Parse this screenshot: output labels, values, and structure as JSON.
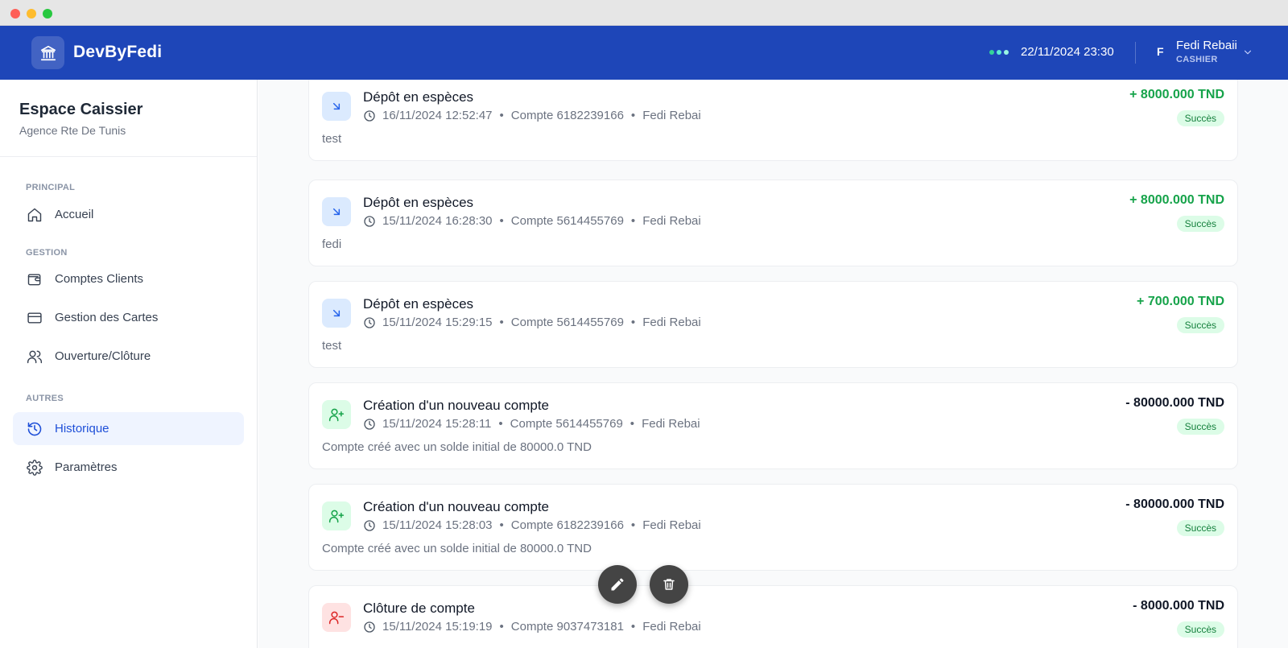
{
  "brand": {
    "name": "DevByFedi",
    "icon": "bank-icon"
  },
  "header": {
    "datetime": "22/11/2024 23:30",
    "status_colors": [
      "#34d399",
      "#5eead4",
      "#99f6e4"
    ],
    "user": {
      "initial": "F",
      "name": "Fedi Rebaii",
      "role": "CASHIER"
    }
  },
  "sidebar": {
    "title": "Espace Caissier",
    "subtitle": "Agence Rte De Tunis",
    "sections": {
      "principal": "PRINCIPAL",
      "gestion": "GESTION",
      "autres": "AUTRES"
    },
    "items": [
      {
        "label": "Accueil",
        "icon": "home-icon"
      },
      {
        "label": "Comptes Clients",
        "icon": "wallet-icon"
      },
      {
        "label": "Gestion des Cartes",
        "icon": "credit-card-icon"
      },
      {
        "label": "Ouverture/Clôture",
        "icon": "users-icon"
      },
      {
        "label": "Historique",
        "icon": "history-icon",
        "active": true
      },
      {
        "label": "Paramètres",
        "icon": "settings-icon"
      }
    ]
  },
  "transactions": [
    {
      "title": "Dépôt en espèces",
      "date": "16/11/2024 12:52:47",
      "account": "Compte 6182239166",
      "user": "Fedi Rebai",
      "desc": "test",
      "amount": "+ 8000.000 TND",
      "status": "Succès",
      "type": "deposit"
    },
    {
      "title": "Dépôt en espèces",
      "date": "15/11/2024 16:28:30",
      "account": "Compte 5614455769",
      "user": "Fedi Rebai",
      "desc": "fedi",
      "amount": "+ 8000.000 TND",
      "status": "Succès",
      "type": "deposit"
    },
    {
      "title": "Dépôt en espèces",
      "date": "15/11/2024 15:29:15",
      "account": "Compte 5614455769",
      "user": "Fedi Rebai",
      "desc": "test",
      "amount": "+ 700.000 TND",
      "status": "Succès",
      "type": "deposit"
    },
    {
      "title": "Création d'un nouveau compte",
      "date": "15/11/2024 15:28:11",
      "account": "Compte 5614455769",
      "user": "Fedi Rebai",
      "desc": "Compte créé avec un solde initial de 80000.0 TND",
      "amount": "- 80000.000 TND",
      "status": "Succès",
      "type": "create"
    },
    {
      "title": "Création d'un nouveau compte",
      "date": "15/11/2024 15:28:03",
      "account": "Compte 6182239166",
      "user": "Fedi Rebai",
      "desc": "Compte créé avec un solde initial de 80000.0 TND",
      "amount": "- 80000.000 TND",
      "status": "Succès",
      "type": "create"
    },
    {
      "title": "Clôture de compte",
      "date": "15/11/2024 15:19:19",
      "account": "Compte 9037473181",
      "user": "Fedi Rebai",
      "desc": "",
      "amount": "- 8000.000 TND",
      "status": "Succès",
      "type": "close"
    }
  ],
  "colors": {
    "primary": "#1e46b8",
    "deposit_amount": "#16a34a",
    "debit_amount": "#111827",
    "deposit_icon_bg": "#dbeafe",
    "create_icon_bg": "#dcfce7",
    "close_icon_bg": "#fee2e2"
  },
  "fab": {
    "edit_icon": "pencil-icon",
    "delete_icon": "trash-icon"
  }
}
